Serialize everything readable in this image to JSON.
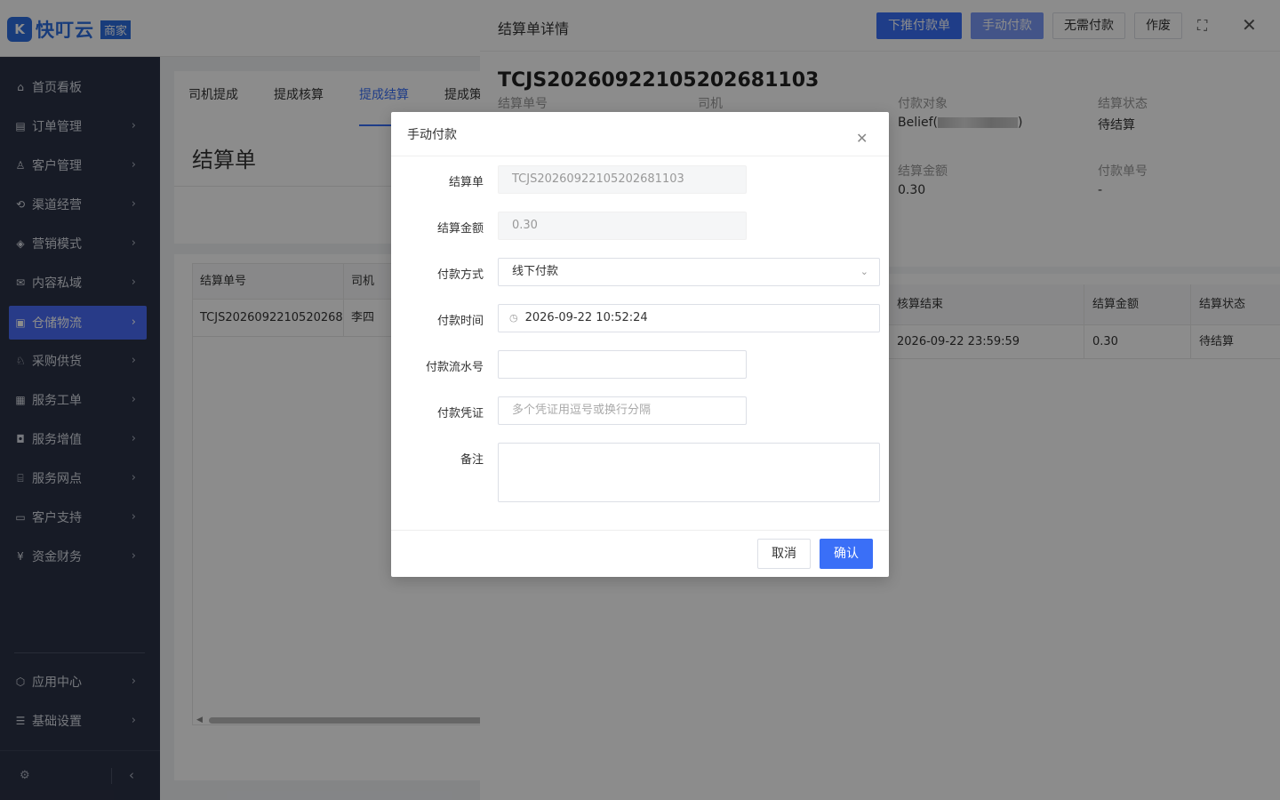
{
  "app": {
    "logo_mark": "K",
    "name": "快叮云",
    "tag": "商家"
  },
  "sidebar": {
    "items": [
      {
        "label": "首页看板",
        "icon": "home-icon",
        "has_chevron": false
      },
      {
        "label": "订单管理",
        "icon": "order-icon",
        "has_chevron": true
      },
      {
        "label": "客户管理",
        "icon": "user-icon",
        "has_chevron": true
      },
      {
        "label": "渠道经营",
        "icon": "channel-icon",
        "has_chevron": true
      },
      {
        "label": "营销模式",
        "icon": "tag-icon",
        "has_chevron": true
      },
      {
        "label": "内容私域",
        "icon": "mail-icon",
        "has_chevron": true
      },
      {
        "label": "仓储物流",
        "icon": "warehouse-icon",
        "has_chevron": true,
        "active": true
      },
      {
        "label": "采购供货",
        "icon": "supplier-icon",
        "has_chevron": true
      },
      {
        "label": "服务工单",
        "icon": "ticket-icon",
        "has_chevron": true
      },
      {
        "label": "服务增值",
        "icon": "bag-icon",
        "has_chevron": true
      },
      {
        "label": "服务网点",
        "icon": "store-icon",
        "has_chevron": true
      },
      {
        "label": "客户支持",
        "icon": "support-icon",
        "has_chevron": true
      },
      {
        "label": "资金财务",
        "icon": "yuan-icon",
        "has_chevron": true
      }
    ],
    "bottom_items": [
      {
        "label": "应用中心",
        "icon": "cube-icon"
      },
      {
        "label": "基础设置",
        "icon": "settings-list-icon"
      }
    ]
  },
  "main": {
    "tabs": [
      "司机提成",
      "提成核算",
      "提成结算",
      "提成策"
    ],
    "active_tab": "提成结算",
    "page_title": "结算单",
    "table": {
      "headers": [
        "结算单号",
        "司机"
      ],
      "rows": [
        [
          "TCJS2026092210520268...",
          "李四"
        ]
      ]
    }
  },
  "drawer": {
    "title": "结算单详情",
    "buttons": {
      "push_payment": "下推付款单",
      "manual_payment": "手动付款",
      "no_payment": "无需付款",
      "void": "作废"
    },
    "settlement_no": "TCJS20260922105202681103",
    "fields": {
      "settlement_no_label": "结算单号",
      "driver_label": "司机",
      "payee_label": "付款对象",
      "payee_value_prefix": "Belief(",
      "payee_value_suffix": ")",
      "status_label": "结算状态",
      "status_value": "待结算",
      "amount_label": "结算金额",
      "amount_value": "0.30",
      "payment_no_label": "付款单号",
      "payment_no_value": "-"
    },
    "table": {
      "headers": [
        "核算结束",
        "结算金额",
        "结算状态"
      ],
      "rows": [
        [
          "2026-09-22 23:59:59",
          "0.30",
          "待结算"
        ]
      ]
    }
  },
  "modal": {
    "title": "手动付款",
    "settlement_label": "结算单",
    "settlement_value": "TCJS20260922105202681103",
    "amount_label": "结算金额",
    "amount_value": "0.30",
    "pay_method_label": "付款方式",
    "pay_method_value": "线下付款",
    "pay_time_label": "付款时间",
    "pay_time_value": "2026-09-22 10:52:24",
    "serial_label": "付款流水号",
    "serial_value": "",
    "voucher_label": "付款凭证",
    "voucher_placeholder": "多个凭证用逗号或换行分隔",
    "remark_label": "备注",
    "remark_value": "",
    "cancel_label": "取消",
    "confirm_label": "确认"
  },
  "colors": {
    "primary": "#3a6ff7",
    "sidebar_bg": "#2b3245",
    "brand": "#2c6de0"
  }
}
